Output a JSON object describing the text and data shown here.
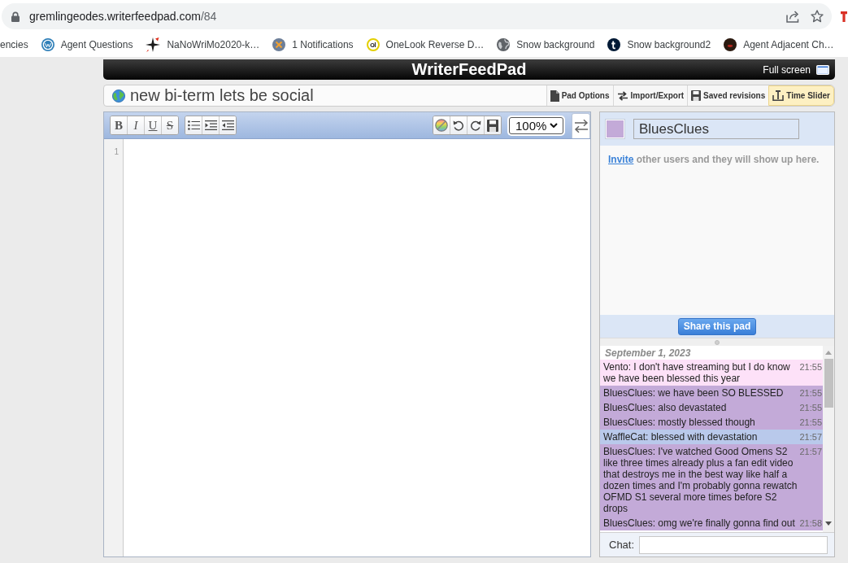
{
  "browser": {
    "url_host": "gremlingeodes.writerfeedpad.com",
    "url_path": "/84"
  },
  "bookmarks": [
    {
      "label": "encies"
    },
    {
      "label": "Agent Questions"
    },
    {
      "label": "NaNoWriMo2020-k…"
    },
    {
      "label": "1 Notifications"
    },
    {
      "label": "OneLook Reverse D…"
    },
    {
      "label": "Snow background"
    },
    {
      "label": "Snow background2"
    },
    {
      "label": "Agent Adjacent Ch…"
    }
  ],
  "header": {
    "title": "WriterFeedPad",
    "fullscreen": "Full screen"
  },
  "pad": {
    "title": "new bi-term lets be social",
    "menu": [
      {
        "label": "Pad Options",
        "highlighted": false
      },
      {
        "label": "Import/Export",
        "highlighted": false
      },
      {
        "label": "Saved revisions",
        "highlighted": false
      },
      {
        "label": "Time Slider",
        "highlighted": true
      }
    ]
  },
  "toolbar": {
    "format_buttons": [
      {
        "label": "B",
        "kind": "bold"
      },
      {
        "label": "I",
        "kind": "italic"
      },
      {
        "label": "U",
        "kind": "underline"
      },
      {
        "label": "S",
        "kind": "strikethrough"
      }
    ],
    "zoom": "100%"
  },
  "editor": {
    "line_numbers": [
      "1"
    ]
  },
  "users": {
    "name": "BluesClues",
    "color": "#c3aad8",
    "invite_link": "Invite",
    "invite_text": "other users and they will show up here.",
    "share_button": "Share this pad"
  },
  "chat": {
    "date": "September 1, 2023",
    "messages": [
      {
        "text": "Vento: I don't have streaming but I do know we have been blessed this year",
        "time": "21:55",
        "color": "#fde1f8"
      },
      {
        "text": "BluesClues: we have been SO BLESSED",
        "time": "21:55",
        "color": "#c3aad8"
      },
      {
        "text": "BluesClues: also devastated",
        "time": "21:55",
        "color": "#c3aad8"
      },
      {
        "text": "BluesClues: mostly blessed though",
        "time": "21:55",
        "color": "#c3aad8"
      },
      {
        "text": "WaffleCat: blessed with devastation",
        "time": "21:57",
        "color": "#b9c9eb"
      },
      {
        "text": "BluesClues: I've watched Good Omens S2 like three times already plus a fan edit video that destroys me in the best way like half a dozen times and I'm probably gonna rewatch OFMD S1 several more times before S2 drops",
        "time": "21:57",
        "color": "#c3aad8"
      },
      {
        "text": "BluesClues: omg we're finally gonna find out",
        "time": "21:58",
        "color": "#c3aad8"
      }
    ],
    "input_label": "Chat:"
  }
}
